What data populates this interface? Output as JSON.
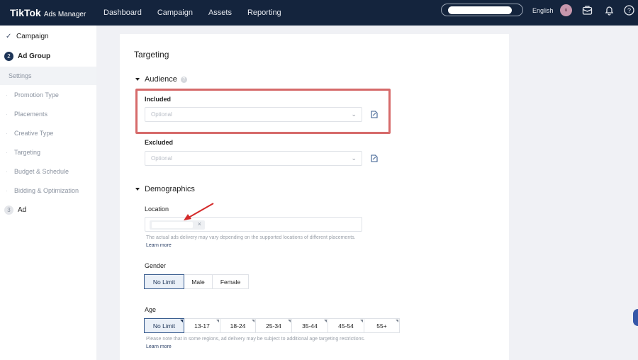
{
  "topbar": {
    "brand": "TikTok",
    "brand_sub": "Ads Manager",
    "nav": [
      "Dashboard",
      "Campaign",
      "Assets",
      "Reporting"
    ],
    "language": "English",
    "avatar_initial": "u"
  },
  "sidebar": {
    "steps": [
      {
        "label": "Campaign",
        "state": "done"
      },
      {
        "label": "Ad Group",
        "number": "2",
        "state": "active"
      },
      {
        "label": "Ad",
        "number": "3",
        "state": "pending"
      }
    ],
    "sub_items": [
      "Settings",
      "Promotion Type",
      "Placements",
      "Creative Type",
      "Targeting",
      "Budget & Schedule",
      "Bidding & Optimization"
    ]
  },
  "main": {
    "title": "Targeting",
    "audience": {
      "heading": "Audience",
      "included_label": "Included",
      "included_placeholder": "Optional",
      "excluded_label": "Excluded",
      "excluded_placeholder": "Optional"
    },
    "demographics": {
      "heading": "Demographics",
      "location_label": "Location",
      "location_hint": "The actual ads delivery may vary depending on the supported locations of different placements.",
      "learn_more": "Learn more",
      "gender_label": "Gender",
      "gender_options": [
        "No Limit",
        "Male",
        "Female"
      ],
      "gender_selected": "No Limit",
      "age_label": "Age",
      "age_options": [
        "No Limit",
        "13-17",
        "18-24",
        "25-34",
        "35-44",
        "45-54",
        "55+"
      ],
      "age_selected": "No Limit",
      "age_hint": "Please note that in some regions, ad delivery may be subject to additional age targeting restrictions.",
      "age_learn_more": "Learn more"
    }
  },
  "colors": {
    "topbar_bg": "#14243d",
    "highlight": "#d66a6a",
    "arrow": "#d42a2a",
    "selected_border": "#3a5d8f"
  }
}
